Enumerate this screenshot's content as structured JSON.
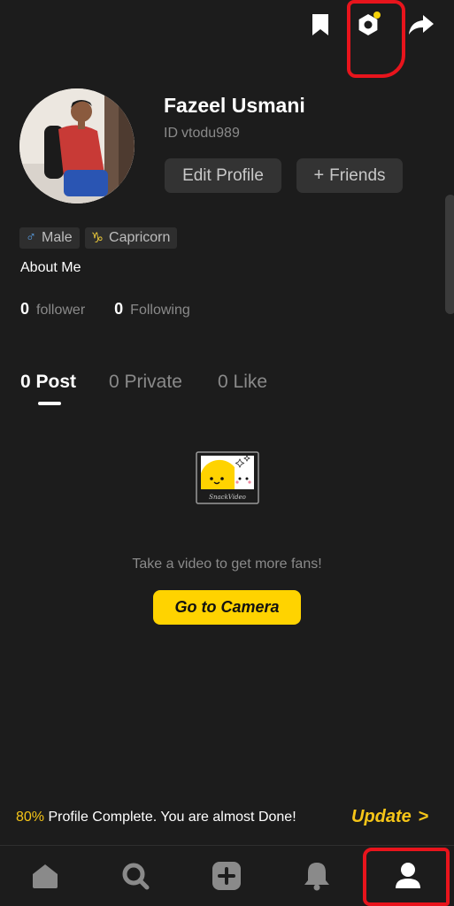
{
  "header": {
    "icons": [
      "bookmark-icon",
      "settings-icon",
      "share-icon"
    ],
    "settings_notification_color": "#f5d20a"
  },
  "profile": {
    "name": "Fazeel Usmani",
    "id_label": "ID",
    "id_value": "vtodu989",
    "edit_button": "Edit Profile",
    "friends_button": "Friends",
    "friends_prefix": "+",
    "tags": [
      {
        "icon": "♂",
        "label": "Male"
      },
      {
        "icon": "♑",
        "label": "Capricorn"
      }
    ],
    "about": "About Me",
    "stats": [
      {
        "count": "0",
        "label": "follower"
      },
      {
        "count": "0",
        "label": "Following"
      }
    ]
  },
  "tabs": [
    {
      "label": "0 Post",
      "active": true
    },
    {
      "label": "0 Private",
      "active": false
    },
    {
      "label": "0 Like",
      "active": false
    }
  ],
  "empty_state": {
    "message": "Take a video to get more fans!",
    "button": "Go to Camera",
    "illustration_caption": "SnackVideo"
  },
  "profile_progress": {
    "percent": "80%",
    "message": "Profile Complete. You are almost Done!",
    "action": "Update",
    "action_chevron": ">"
  },
  "bottom_nav": {
    "items": [
      "home-icon",
      "search-icon",
      "add-icon",
      "notifications-icon",
      "profile-icon"
    ],
    "active": "profile-icon"
  },
  "colors": {
    "background": "#1c1c1c",
    "accent": "#ffd300",
    "annotation": "#e8141c"
  }
}
